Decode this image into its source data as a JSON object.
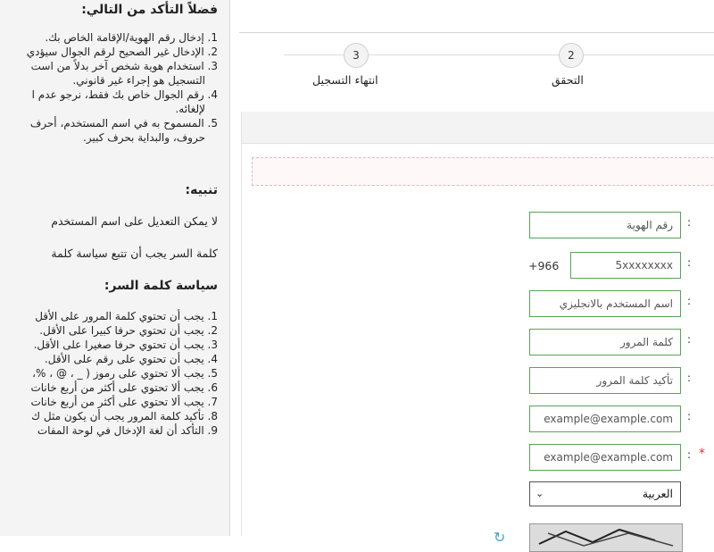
{
  "sidebar": {
    "heading1": "فضلاً التأكد من التالي:",
    "notes": [
      "1. إدخال رقم الهوية/الإقامة الخاص بك.",
      "2. الإدخال غير الصحيح لرقم الجوال سيؤدي",
      "3. استخدام هوية شخص آخر بدلاً من است",
      "التسجيل هو إجراء غير قانوني.",
      "4. رقم الجوال خاص بك فقط، نرجو عدم ا",
      "لإلغائه.",
      "5. المسموح به في اسم المستخدم، أحرف",
      "حروف، والبداية بحرف كبير."
    ],
    "heading2": "تنبيه:",
    "warn1": "لا يمكن التعديل على اسم المستخدم",
    "warn2": "كلمة السر يجب أن تتبع سياسة كلمة",
    "heading3": "سياسة كلمة السر:",
    "policy": [
      "1. يجب أن تحتوي كلمة المرور على الأقل",
      "2. يجب أن تحتوي حرفا كبيرا على الأقل.",
      "3. يجب أن تحتوي حرفا صغيرا على الأقل.",
      "4. يجب أن تحتوي على رقم على الأقل.",
      "5. يجب ألا تحتوي على رموز ( _ ، @ ، %،",
      "6. يجب ألا تحتوي على أكثر من أربع خانات",
      "7. يجب ألا تحتوي على أكثر من أربع خانات",
      "8. تأكيد كلمة المرور يجب أن يكون مثل ك",
      "9. التأكد أن لغة الإدخال في لوحة المفات"
    ]
  },
  "steps": [
    {
      "number": "3",
      "label": "انتهاء التسجيل"
    },
    {
      "number": "2",
      "label": "التحقق"
    }
  ],
  "form": {
    "id_placeholder": "رقم الهوية",
    "country_code": "+966",
    "mobile_placeholder": "5xxxxxxxx",
    "username_placeholder": "اسم المستخدم بالانجليزي",
    "password_placeholder": "كلمة المرور",
    "confirm_placeholder": "تأكيد كلمة المرور",
    "email_placeholder": "example@example.com",
    "email_confirm_placeholder": "example@example.com",
    "language_selected": "العربية",
    "colon": ":",
    "required_mark": "*"
  },
  "colors": {
    "field_border": "#5aa25a",
    "required": "#d9303f",
    "alert_border": "#e7b4bd"
  }
}
